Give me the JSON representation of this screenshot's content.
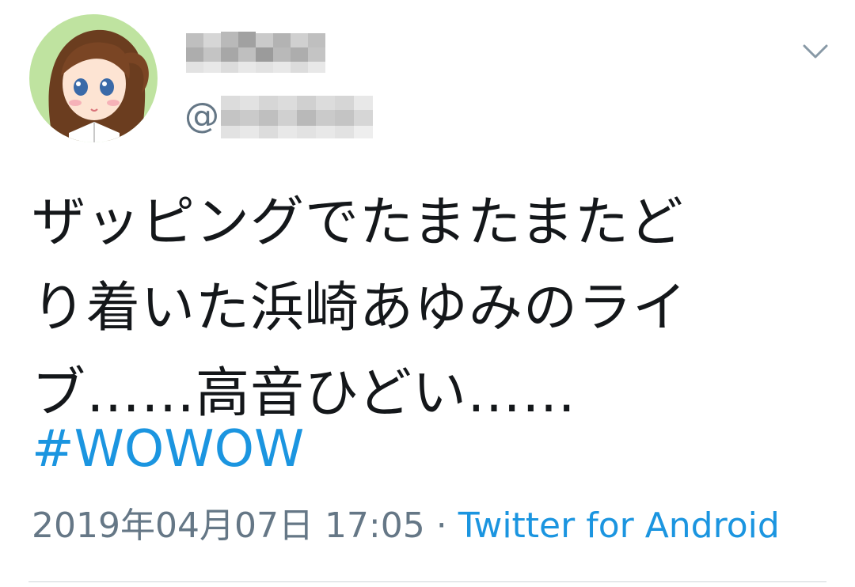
{
  "tweet": {
    "handle_prefix": "@",
    "text": "ザッピングでたまたまたど\nり着いた浜崎あゆみのライ\nブ……高音ひどい……",
    "hashtag": "#WOWOW",
    "timestamp": "2019年04月07日 17:05",
    "separator": "·",
    "source": "Twitter for Android"
  },
  "icons": {
    "menu": "chevron-down-icon",
    "avatar": "avatar-illustration"
  },
  "colors": {
    "text": "#14171a",
    "secondary": "#657786",
    "link": "#1b95e0",
    "divider": "#d0d5d9"
  }
}
